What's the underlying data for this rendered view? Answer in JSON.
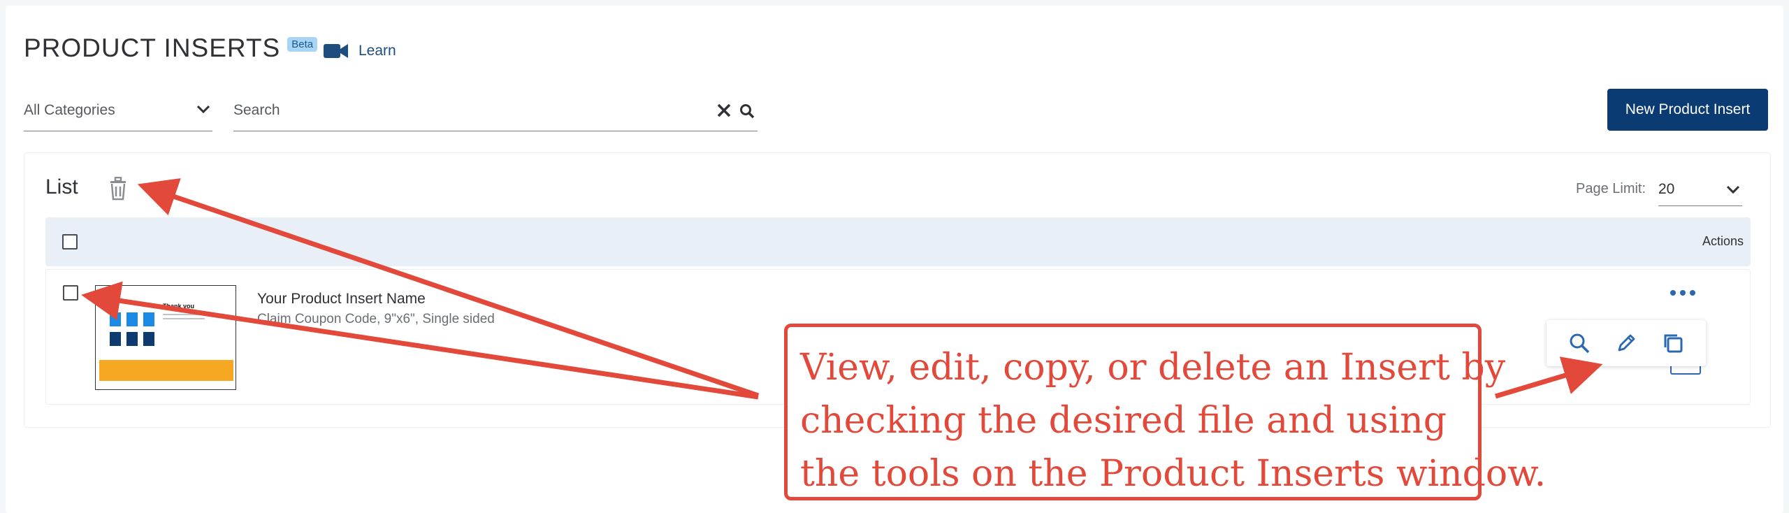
{
  "header": {
    "title": "PRODUCT INSERTS",
    "badge": "Beta",
    "learn_label": "Learn"
  },
  "filters": {
    "category_value": "All Categories",
    "search_placeholder": "Search"
  },
  "toolbar": {
    "new_button_label": "New Product Insert"
  },
  "list": {
    "title": "List",
    "page_limit_label": "Page Limit:",
    "page_limit_value": "20",
    "columns": [
      "Actions"
    ],
    "rows": [
      {
        "name": "Your Product Insert Name",
        "meta": "Claim Coupon Code, 9\"x6\", Single sided",
        "thumbnail_text": "Thank you"
      }
    ]
  },
  "row_tools": [
    "search-icon",
    "pencil-icon",
    "copy-icon"
  ],
  "callout": {
    "lines": [
      "View, edit, copy, or delete an Insert by",
      "checking the desired file and using",
      "the tools on the Product Inserts window."
    ]
  },
  "colors": {
    "primary": "#0a3b72",
    "annotation": "#e2493a",
    "header_row": "#e8eff6",
    "link": "#1e4d80"
  }
}
